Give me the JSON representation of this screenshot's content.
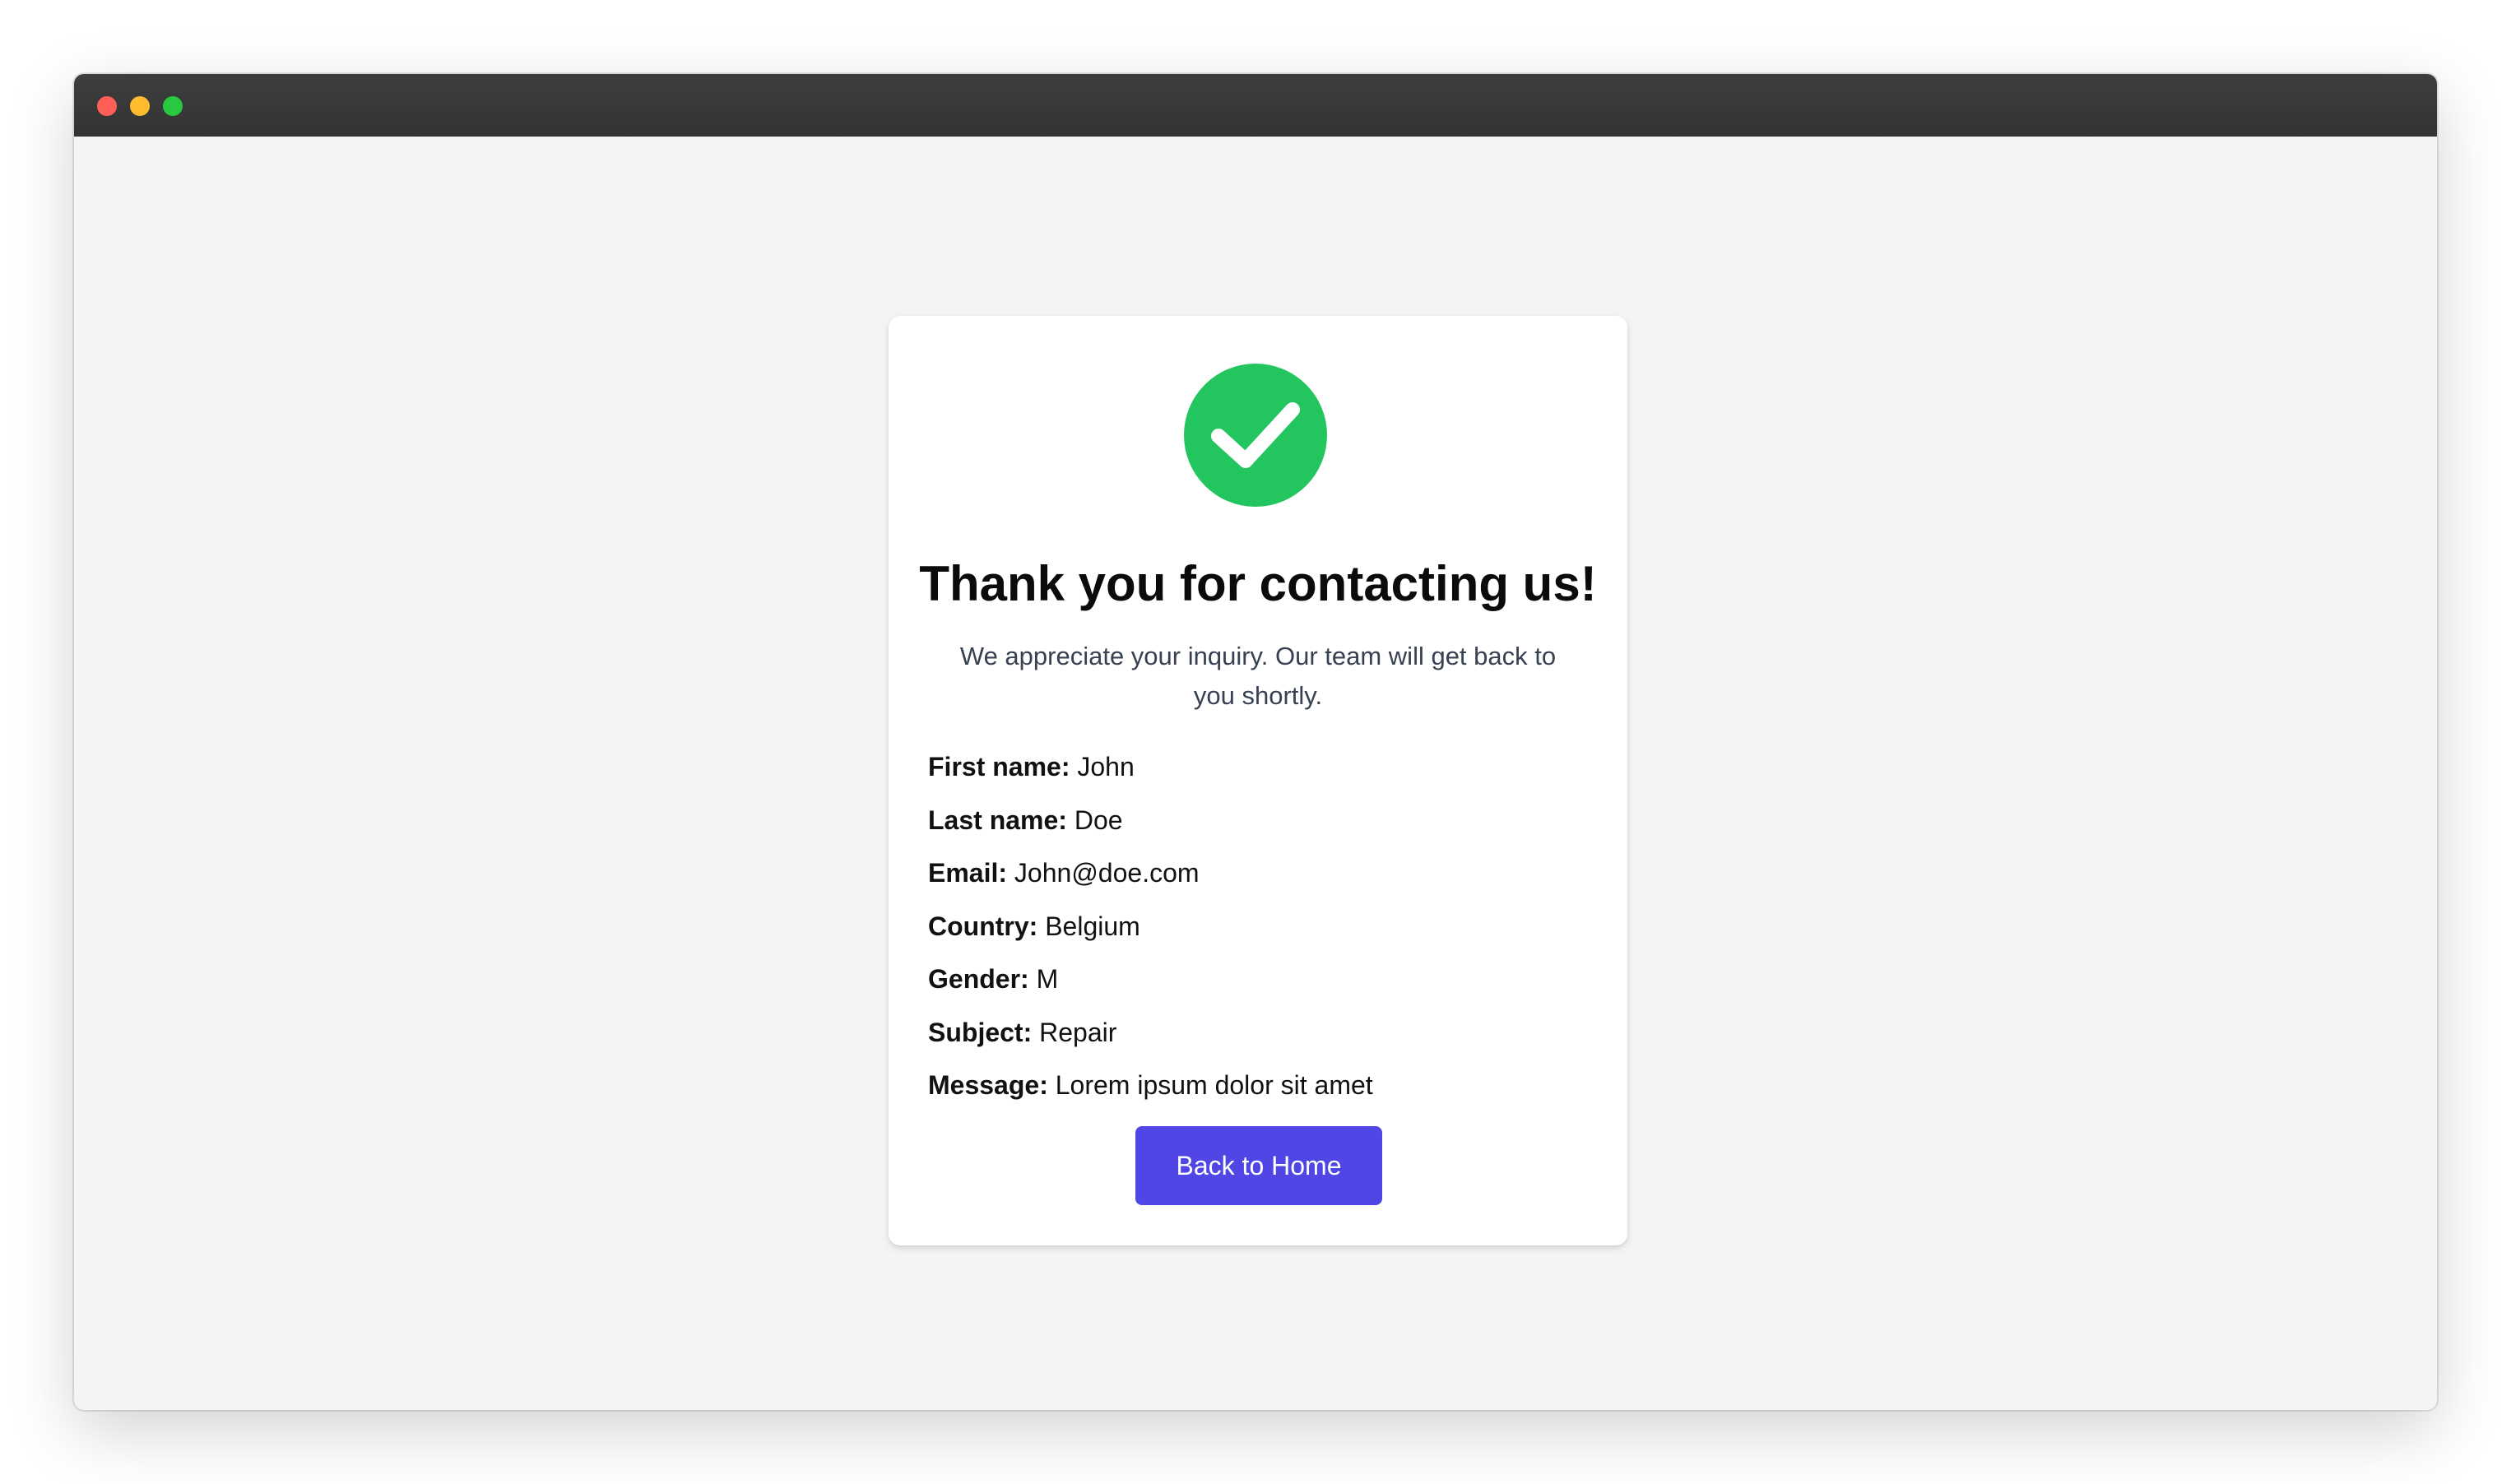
{
  "window": {
    "traffic_lights": [
      {
        "name": "close",
        "color": "#ff5f57"
      },
      {
        "name": "minimize",
        "color": "#febc2e"
      },
      {
        "name": "zoom",
        "color": "#28c840"
      }
    ]
  },
  "colors": {
    "success_green": "#22c55e",
    "button_indigo": "#4f46e5",
    "page_background": "#f3f4f6"
  },
  "confirmation": {
    "icon": "check-circle-icon",
    "title": "Thank you for contacting us!",
    "subtitle": "We appreciate your inquiry. Our team will get back to you shortly.",
    "fields": [
      {
        "label": "First name:",
        "value": "John"
      },
      {
        "label": "Last name:",
        "value": "Doe"
      },
      {
        "label": "Email:",
        "value": "John@doe.com"
      },
      {
        "label": "Country:",
        "value": "Belgium"
      },
      {
        "label": "Gender:",
        "value": "M"
      },
      {
        "label": "Subject:",
        "value": "Repair"
      },
      {
        "label": "Message:",
        "value": "Lorem ipsum dolor sit amet"
      }
    ],
    "back_button_label": "Back to Home"
  }
}
